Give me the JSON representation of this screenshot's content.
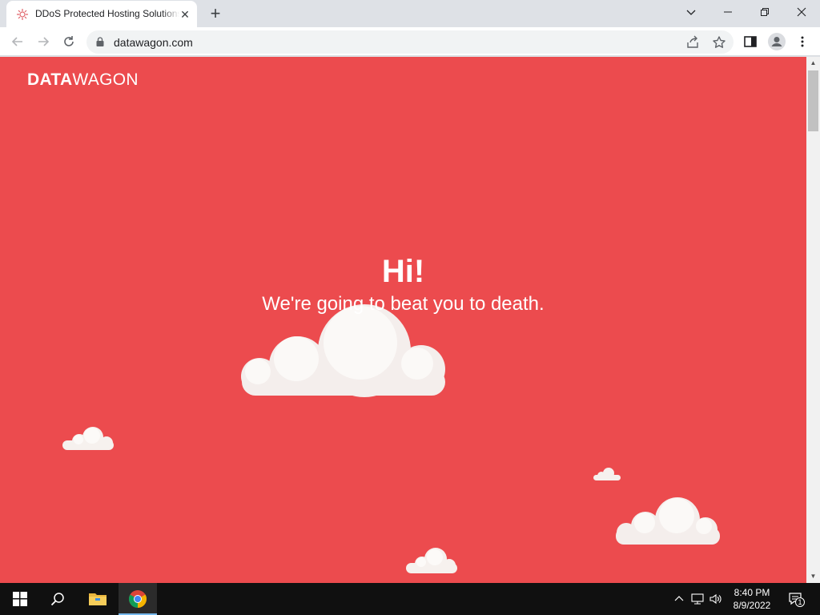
{
  "browser": {
    "tab_title": "DDoS Protected Hosting Solutions",
    "url": "datawagon.com",
    "accent": "#dee1e6"
  },
  "page": {
    "logo_bold": "DATA",
    "logo_light": "WAGON",
    "headline": "Hi!",
    "subline": "We're going to beat you to death.",
    "background_color": "#ec4b4e",
    "cloud_color": "#f7f3f0"
  },
  "taskbar": {
    "time": "8:40 PM",
    "date": "8/9/2022",
    "notification_count": "1"
  }
}
